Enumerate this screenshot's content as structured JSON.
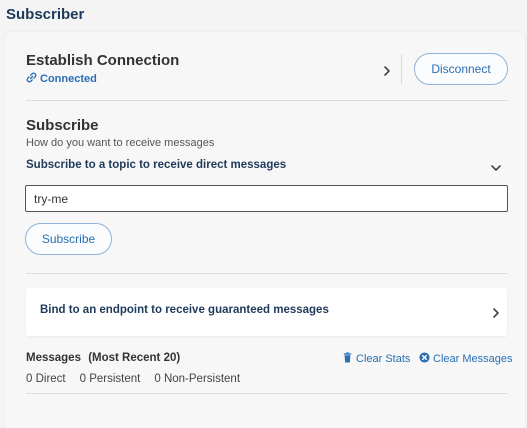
{
  "page": {
    "title": "Subscriber"
  },
  "connection": {
    "title": "Establish Connection",
    "status": "Connected",
    "disconnect_label": "Disconnect"
  },
  "subscribe": {
    "title": "Subscribe",
    "description": "How do you want to receive messages",
    "topic_heading": "Subscribe to a topic to receive direct messages",
    "topic_value": "try-me",
    "button_label": "Subscribe"
  },
  "bind": {
    "label": "Bind to an endpoint to receive guaranteed messages"
  },
  "messages": {
    "title": "Messages",
    "subtitle": "(Most Recent 20)",
    "clear_stats": "Clear Stats",
    "clear_messages": "Clear Messages",
    "direct": "0 Direct",
    "persistent": "0 Persistent",
    "non_persistent": "0 Non-Persistent"
  },
  "colors": {
    "accent": "#2a6fb3",
    "heading": "#1f3a5a",
    "button_border": "#8fb3d9"
  },
  "icons": {
    "status": "link-icon",
    "expand": "chevron-right-icon",
    "collapse": "chevron-down-icon",
    "clear_stats": "trash-icon",
    "clear_messages": "close-circle-icon"
  }
}
